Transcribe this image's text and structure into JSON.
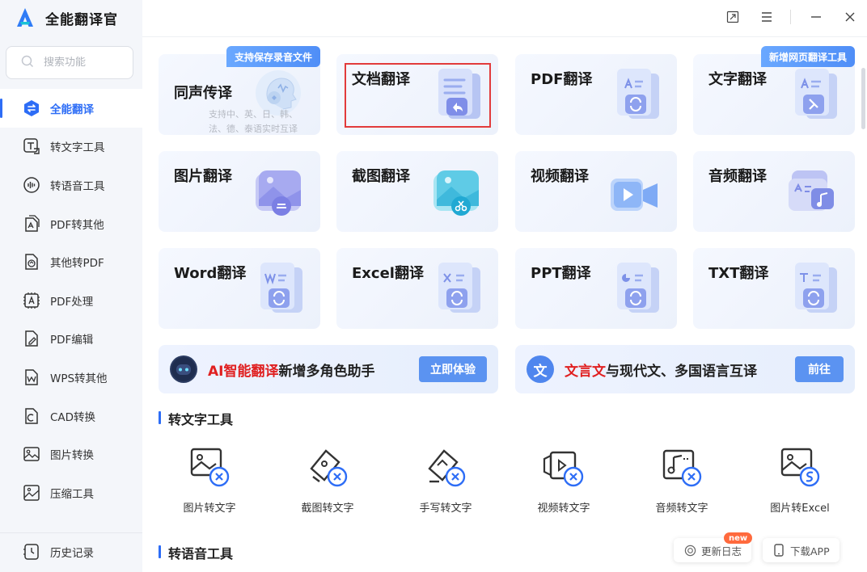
{
  "app": {
    "name": "全能翻译官"
  },
  "search": {
    "placeholder": "搜索功能"
  },
  "sidebar": {
    "items": [
      {
        "label": "全能翻译",
        "icon": "translate-icon",
        "active": true
      },
      {
        "label": "转文字工具",
        "icon": "text-convert-icon"
      },
      {
        "label": "转语音工具",
        "icon": "voice-icon"
      },
      {
        "label": "PDF转其他",
        "icon": "pdf-export-icon"
      },
      {
        "label": "其他转PDF",
        "icon": "pdf-import-icon"
      },
      {
        "label": "PDF处理",
        "icon": "pdf-process-icon"
      },
      {
        "label": "PDF编辑",
        "icon": "pdf-edit-icon"
      },
      {
        "label": "WPS转其他",
        "icon": "wps-icon"
      },
      {
        "label": "CAD转换",
        "icon": "cad-icon"
      },
      {
        "label": "图片转换",
        "icon": "image-convert-icon"
      },
      {
        "label": "压缩工具",
        "icon": "compress-icon"
      }
    ],
    "history_label": "历史记录"
  },
  "window_controls": [
    "restore-icon",
    "menu-icon",
    "minimize-icon",
    "close-icon"
  ],
  "cards": [
    {
      "title": "同声传译",
      "subtitle": "支持中、英、日、韩、法、德、泰语实时互译",
      "tag": "支持保存录音文件"
    },
    {
      "title": "文档翻译"
    },
    {
      "title": "PDF翻译"
    },
    {
      "title": "文字翻译",
      "tag": "新增网页翻译工具"
    },
    {
      "title": "图片翻译"
    },
    {
      "title": "截图翻译"
    },
    {
      "title": "视频翻译"
    },
    {
      "title": "音频翻译"
    },
    {
      "title": "Word翻译"
    },
    {
      "title": "Excel翻译"
    },
    {
      "title": "PPT翻译"
    },
    {
      "title": "TXT翻译"
    }
  ],
  "banners": [
    {
      "highlight": "AI智能翻译",
      "text": "新增多角色助手",
      "button": "立即体验"
    },
    {
      "highlight": "文言文",
      "text": "与现代文、多国语言互译",
      "button": "前往",
      "icon_glyph": "文"
    }
  ],
  "sections": [
    {
      "title": "转文字工具",
      "tools": [
        "图片转文字",
        "截图转文字",
        "手写转文字",
        "视频转文字",
        "音频转文字",
        "图片转Excel"
      ]
    },
    {
      "title": "转语音工具"
    }
  ],
  "footer": {
    "changelog": "更新日志",
    "new_badge": "new",
    "download": "下载APP"
  },
  "colors": {
    "accent": "#2d6df6",
    "highlight": "#e02020",
    "selection": "#e23b3b"
  }
}
